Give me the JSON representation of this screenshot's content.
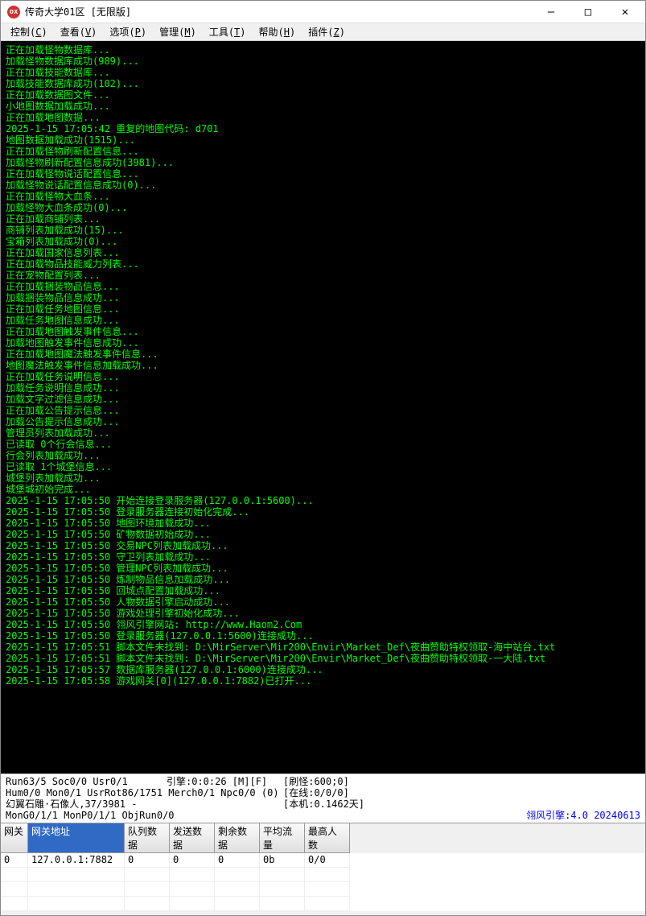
{
  "window": {
    "title": "传奇大学01区 [无限版]",
    "icon_text": "ox"
  },
  "menu": {
    "items": [
      {
        "label": "控制",
        "key": "C"
      },
      {
        "label": "查看",
        "key": "V"
      },
      {
        "label": "选项",
        "key": "P"
      },
      {
        "label": "管理",
        "key": "M"
      },
      {
        "label": "工具",
        "key": "T"
      },
      {
        "label": "帮助",
        "key": "H"
      },
      {
        "label": "插件",
        "key": "Z"
      }
    ]
  },
  "console_lines": [
    "正在加载怪物数据库...",
    "加载怪物数据库成功(989)...",
    "正在加载技能数据库...",
    "加载技能数据库成功(102)...",
    "正在加载数据图文件...",
    "小地图数据加载成功...",
    "正在加载地图数据...",
    "2025-1-15 17:05:42 重复的地图代码: d701",
    "地图数据加载成功(1515)...",
    "正在加载怪物刷新配置信息...",
    "加载怪物刷新配置信息成功(3981)...",
    "正在加载怪物说话配置信息...",
    "加载怪物说话配置信息成功(0)...",
    "正在加载怪物大血条...",
    "加载怪物大血条成功(0)...",
    "正在加载商铺列表...",
    "商铺列表加载成功(15)...",
    "宝箱列表加载成功(0)...",
    "正在加载国家信息列表...",
    "正在加载物品技能威力列表...",
    "正在宠物配置列表...",
    "正在加载捆装物品信息...",
    "加载捆装物品信息成功...",
    "正在加载任务地图信息...",
    "加载任务地图信息成功...",
    "正在加载地图触发事件信息...",
    "加载地图触发事件信息成功...",
    "正在加载地图魔法触发事件信息...",
    "地图魔法触发事件信息加载成功...",
    "正在加载任务说明信息...",
    "加载任务说明信息成功...",
    "加载文字过滤信息成功...",
    "正在加载公告提示信息...",
    "加载公告提示信息成功...",
    "管理员列表加载成功...",
    "已读取 0个行会信息...",
    "行会列表加载成功...",
    "已读取 1个城堡信息...",
    "城堡列表加载成功...",
    "城堡城初始完成...",
    "2025-1-15 17:05:50 开始连接登录服务器(127.0.0.1:5600)...",
    "2025-1-15 17:05:50 登录服务器连接初始化完成...",
    "2025-1-15 17:05:50 地图环境加载成功...",
    "2025-1-15 17:05:50 矿物数据初始成功...",
    "2025-1-15 17:05:50 交易NPC列表加载成功...",
    "2025-1-15 17:05:50 守卫列表加载成功...",
    "2025-1-15 17:05:50 管理NPC列表加载成功...",
    "2025-1-15 17:05:50 炼制物品信息加载成功...",
    "2025-1-15 17:05:50 回城点配置加载成功...",
    "2025-1-15 17:05:50 人物数据引擎启动成功...",
    "2025-1-15 17:05:50 游戏处理引擎初始化成功...",
    "2025-1-15 17:05:50 翎风引擎网站: http://www.Haom2.Com",
    "2025-1-15 17:05:50 登录服务器(127.0.0.1:5600)连接成功...",
    "2025-1-15 17:05:51 脚本文件未找到: D:\\MirServer\\Mir200\\Envir\\Market_Def\\夜曲赞助特权领取-海中站台.txt",
    "2025-1-15 17:05:51 脚本文件未找到: D:\\MirServer\\Mir200\\Envir\\Market_Def\\夜曲赞助特权领取-一大陆.txt",
    "2025-1-15 17:05:57 数据库服务器(127.0.0.1:6000)连接成功...",
    "2025-1-15 17:05:58 游戏网关[0](127.0.0.1:7882)已打开..."
  ],
  "status": {
    "row1": {
      "col1": "Run63/5 Soc0/0 Usr0/1",
      "col2": "引擎:0:0:26 [M][F]",
      "col3": "[刷怪:600;0]"
    },
    "row2": {
      "col1": "Hum0/0 Mon0/1 UsrRot86/1751 Merch0/1 Npc0/0 (0)",
      "col3": "[在线:0/0/0]"
    },
    "row3": {
      "col1": "幻翼石雕·石像人,37/3981 -",
      "col3": "[本机:0.1462天]"
    },
    "row4": {
      "col1": "MonG0/1/1 MonP0/1/1 ObjRun0/0",
      "engine": "翎风引擎:4.0 20240613"
    }
  },
  "grid": {
    "headers": [
      "网关",
      "网关地址",
      "队列数据",
      "发送数据",
      "剩余数据",
      "平均流量",
      "最高人数"
    ],
    "rows": [
      {
        "c0": "0",
        "c1": "127.0.0.1:7882",
        "c2": "0",
        "c3": "0",
        "c4": "0",
        "c5": "0b",
        "c6": "0/0"
      },
      {
        "c0": "",
        "c1": "",
        "c2": "",
        "c3": "",
        "c4": "",
        "c5": "",
        "c6": ""
      },
      {
        "c0": "",
        "c1": "",
        "c2": "",
        "c3": "",
        "c4": "",
        "c5": "",
        "c6": ""
      },
      {
        "c0": "",
        "c1": "",
        "c2": "",
        "c3": "",
        "c4": "",
        "c5": "",
        "c6": ""
      }
    ]
  }
}
